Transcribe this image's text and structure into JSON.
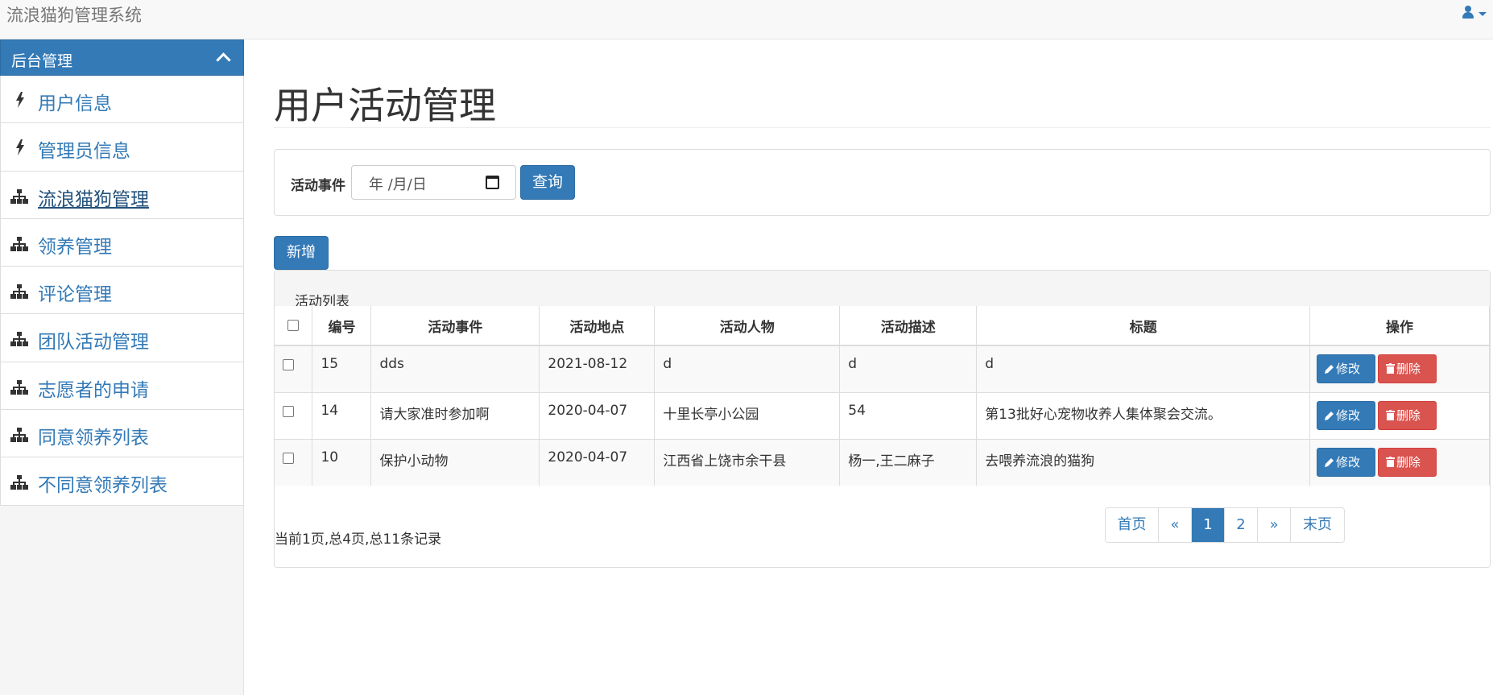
{
  "app": {
    "title": "流浪猫狗管理系统"
  },
  "sidebar": {
    "header": "后台管理",
    "items": [
      {
        "label": "用户信息",
        "icon": "bolt-icon"
      },
      {
        "label": "管理员信息",
        "icon": "bolt-icon"
      },
      {
        "label": "流浪猫狗管理",
        "icon": "sitemap-icon",
        "active": true
      },
      {
        "label": "领养管理",
        "icon": "sitemap-icon"
      },
      {
        "label": "评论管理",
        "icon": "sitemap-icon"
      },
      {
        "label": "团队活动管理",
        "icon": "sitemap-icon"
      },
      {
        "label": "志愿者的申请",
        "icon": "sitemap-icon"
      },
      {
        "label": "同意领养列表",
        "icon": "sitemap-icon"
      },
      {
        "label": "不同意领养列表",
        "icon": "sitemap-icon"
      }
    ]
  },
  "page": {
    "title": "用户活动管理"
  },
  "search": {
    "label": "活动事件",
    "date_placeholder": "年 /月/日",
    "button": "查询"
  },
  "toolbar": {
    "add_label": "新增"
  },
  "list": {
    "heading": "活动列表",
    "columns": [
      "编号",
      "活动事件",
      "活动地点",
      "活动人物",
      "活动描述",
      "标题",
      "操作"
    ],
    "rows": [
      {
        "id": "15",
        "event": "dds",
        "place": "2021-08-12",
        "person": "d",
        "desc": "d",
        "title": "d"
      },
      {
        "id": "14",
        "event": "请大家准时参加啊",
        "place": "2020-04-07",
        "person": "十里长亭小公园",
        "desc": "54",
        "title": "第13批好心宠物收养人集体聚会交流。"
      },
      {
        "id": "10",
        "event": "保护小动物",
        "place": "2020-04-07",
        "person": "江西省上饶市余干县",
        "desc": "杨一,王二麻子",
        "title": "去喂养流浪的猫狗"
      }
    ],
    "edit_label": "修改",
    "delete_label": "删除"
  },
  "pagination": {
    "summary": "当前1页,总4页,总11条记录",
    "first": "首页",
    "prev": "«",
    "pages": [
      "1",
      "2"
    ],
    "next": "»",
    "last": "末页",
    "current": "1"
  },
  "colors": {
    "primary": "#337ab7",
    "danger": "#d9534f"
  }
}
